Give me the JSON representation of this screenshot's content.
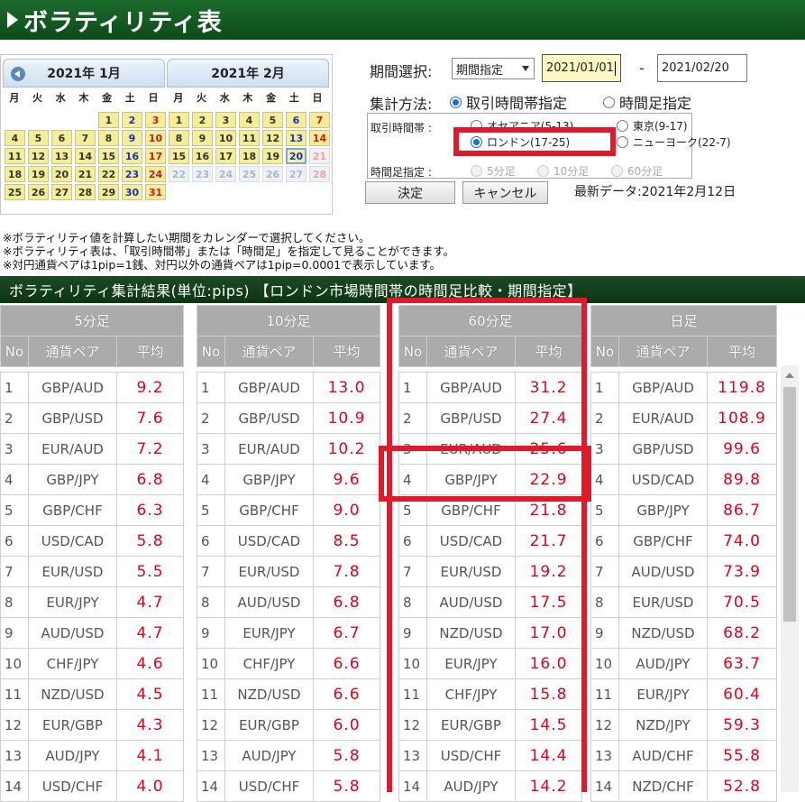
{
  "page_title": "ボラティリティ表",
  "calendar": [
    {
      "title": "2021年 1月",
      "weekdays": [
        "月",
        "火",
        "水",
        "木",
        "金",
        "土",
        "日"
      ],
      "lead": 4,
      "days": 31,
      "outside": []
    },
    {
      "title": "2021年 2月",
      "weekdays": [
        "月",
        "火",
        "水",
        "木",
        "金",
        "土",
        "日"
      ],
      "lead": 0,
      "days": 28,
      "outside": [
        21,
        22,
        23,
        24,
        25,
        26,
        27,
        28
      ],
      "today": 20
    }
  ],
  "form": {
    "period_label": "期間選択:",
    "period_value": "期間指定",
    "date_from": "2021/01/01",
    "date_sep": "-",
    "date_to": "2021/02/20",
    "agg_label": "集計方法:",
    "agg_options": [
      "取引時間帯指定",
      "時間足指定"
    ],
    "session_label": "取引時間帯 :",
    "sessions": [
      "オセアニア(5-13)",
      "東京(9-17)",
      "ロンドン(17-25)",
      "ニューヨーク(22-7)"
    ],
    "timeframe_label": "時間足指定 :",
    "timeframes": [
      "5分足",
      "10分足",
      "60分足"
    ],
    "ok_button": "決定",
    "cancel_button": "キャンセル",
    "latest_data": "最新データ:2021年2月12日"
  },
  "notes": [
    "※ボラティリティ値を計算したい期間をカレンダーで選択してください。",
    "※ボラティリティ表は、「取引時間帯」または「時間足」を指定して見ることができます。",
    "※対円通貨ペアは1pip=1銭、対円以外の通貨ペアは1pip=0.0001で表示しています。"
  ],
  "result_title": "ボラティリティ集計結果(単位:pips) 【ロンドン市場時間帯の時間足比較・期間指定】",
  "table_headers": {
    "no": "No",
    "pair": "通貨ペア",
    "avg": "平均"
  },
  "tables": [
    {
      "title": "5分足",
      "rows": [
        [
          "1",
          "GBP/AUD",
          "9.2"
        ],
        [
          "2",
          "GBP/USD",
          "7.6"
        ],
        [
          "3",
          "EUR/AUD",
          "7.2"
        ],
        [
          "4",
          "GBP/JPY",
          "6.8"
        ],
        [
          "5",
          "GBP/CHF",
          "6.3"
        ],
        [
          "6",
          "USD/CAD",
          "5.8"
        ],
        [
          "7",
          "EUR/USD",
          "5.5"
        ],
        [
          "8",
          "EUR/JPY",
          "4.7"
        ],
        [
          "9",
          "AUD/USD",
          "4.7"
        ],
        [
          "10",
          "CHF/JPY",
          "4.6"
        ],
        [
          "11",
          "NZD/USD",
          "4.5"
        ],
        [
          "12",
          "EUR/GBP",
          "4.3"
        ],
        [
          "13",
          "AUD/JPY",
          "4.1"
        ],
        [
          "14",
          "USD/CHF",
          "4.0"
        ]
      ]
    },
    {
      "title": "10分足",
      "rows": [
        [
          "1",
          "GBP/AUD",
          "13.0"
        ],
        [
          "2",
          "GBP/USD",
          "10.9"
        ],
        [
          "3",
          "EUR/AUD",
          "10.2"
        ],
        [
          "4",
          "GBP/JPY",
          "9.6"
        ],
        [
          "5",
          "GBP/CHF",
          "9.0"
        ],
        [
          "6",
          "USD/CAD",
          "8.5"
        ],
        [
          "7",
          "EUR/USD",
          "7.8"
        ],
        [
          "8",
          "AUD/USD",
          "6.8"
        ],
        [
          "9",
          "EUR/JPY",
          "6.7"
        ],
        [
          "10",
          "CHF/JPY",
          "6.6"
        ],
        [
          "11",
          "NZD/USD",
          "6.6"
        ],
        [
          "12",
          "EUR/GBP",
          "6.0"
        ],
        [
          "13",
          "AUD/JPY",
          "5.8"
        ],
        [
          "14",
          "USD/CHF",
          "5.8"
        ]
      ]
    },
    {
      "title": "60分足",
      "rows": [
        [
          "1",
          "GBP/AUD",
          "31.2"
        ],
        [
          "2",
          "GBP/USD",
          "27.4"
        ],
        [
          "3",
          "EUR/AUD",
          "25.6"
        ],
        [
          "4",
          "GBP/JPY",
          "22.9"
        ],
        [
          "5",
          "GBP/CHF",
          "21.8"
        ],
        [
          "6",
          "USD/CAD",
          "21.7"
        ],
        [
          "7",
          "EUR/USD",
          "19.2"
        ],
        [
          "8",
          "AUD/USD",
          "17.5"
        ],
        [
          "9",
          "NZD/USD",
          "17.0"
        ],
        [
          "10",
          "EUR/JPY",
          "16.0"
        ],
        [
          "11",
          "CHF/JPY",
          "15.8"
        ],
        [
          "12",
          "EUR/GBP",
          "14.5"
        ],
        [
          "13",
          "USD/CHF",
          "14.4"
        ],
        [
          "14",
          "AUD/JPY",
          "14.2"
        ]
      ]
    },
    {
      "title": "日足",
      "rows": [
        [
          "1",
          "GBP/AUD",
          "119.8"
        ],
        [
          "2",
          "EUR/AUD",
          "108.9"
        ],
        [
          "3",
          "GBP/USD",
          "99.6"
        ],
        [
          "4",
          "USD/CAD",
          "89.8"
        ],
        [
          "5",
          "GBP/JPY",
          "86.7"
        ],
        [
          "6",
          "GBP/CHF",
          "74.0"
        ],
        [
          "7",
          "AUD/USD",
          "73.9"
        ],
        [
          "8",
          "EUR/USD",
          "70.5"
        ],
        [
          "9",
          "NZD/USD",
          "68.2"
        ],
        [
          "10",
          "AUD/JPY",
          "63.7"
        ],
        [
          "11",
          "EUR/JPY",
          "60.4"
        ],
        [
          "12",
          "NZD/JPY",
          "59.3"
        ],
        [
          "13",
          "AUD/CHF",
          "55.8"
        ],
        [
          "14",
          "NZD/CHF",
          "52.8"
        ]
      ]
    }
  ],
  "colors": {
    "header_green": "#0d4a1a",
    "value_red": "#e8001b",
    "highlight_red": "#e01a2b",
    "calendar_yellow": "#f4ee98"
  }
}
